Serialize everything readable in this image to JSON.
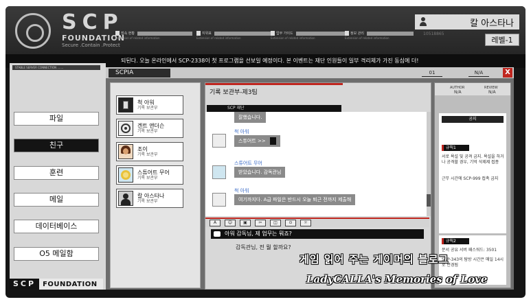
{
  "header": {
    "brand_name": "SCP",
    "brand_sub": "FOUNDATION",
    "brand_motto": "Secure .Contain .Protect",
    "fields": [
      {
        "label": "접속 현황",
        "sub": "Extension of related information"
      },
      {
        "label": "지위표",
        "sub": "Extension of related information"
      },
      {
        "label": "업무 가이드",
        "sub": "Extension of related information"
      },
      {
        "label": "정보 관리",
        "sub": "Extension of related information"
      }
    ],
    "user_name": "칼 아스타나",
    "user_id": "10518865",
    "level": "레벨-1"
  },
  "ticker": "되된다. 오늘 온라인에서 SCP-2338이 첫 프로그램을 선보일 예정이다. 본 이벤트는 재단 인원들이 일부 격리체가 가진 동심에 더!",
  "sidebar": {
    "connection_label": "STABLE SERVER CONNECTION .......",
    "items": [
      {
        "label": "파일",
        "active": false
      },
      {
        "label": "친구",
        "active": true
      },
      {
        "label": "훈련",
        "active": false
      },
      {
        "label": "메일",
        "active": false
      },
      {
        "label": "데이터베이스",
        "active": false
      },
      {
        "label": "O5 메일함",
        "active": false
      }
    ],
    "footer_logo": "SCP",
    "footer_text": "FOUNDATION"
  },
  "window": {
    "title": "SCPIA",
    "top_cells": [
      "01",
      "N/A"
    ],
    "close_label": "X"
  },
  "contacts": [
    {
      "name": "척 아워",
      "role": "기록 보관부",
      "avatar_icon": "robot-avatar-icon"
    },
    {
      "name": "겐트 앤더슨",
      "role": "기록 보관부",
      "avatar_icon": "target-avatar-icon"
    },
    {
      "name": "조이",
      "role": "기록 보관부",
      "avatar_icon": "woman-avatar-icon"
    },
    {
      "name": "스튜어트 무어",
      "role": "기록 보관부",
      "avatar_icon": "lion-avatar-icon"
    },
    {
      "name": "칼 아스타나",
      "role": "기록 보관부",
      "avatar_icon": "silhouette-avatar-icon"
    }
  ],
  "chat": {
    "title": "기록 보관부-제3팀",
    "subtitle": "SCP 재단",
    "messages": [
      {
        "name": "",
        "text": "잘했습니다."
      },
      {
        "name": "척 아워",
        "text": "스튜어트 >>"
      },
      {
        "name": "스튜어트 무어",
        "text": "받았습니다. 감독관님"
      },
      {
        "name": "척 아워",
        "text": "여기까지다. A급 파일은 반드시 오늘 퇴근 전까지 제출해"
      }
    ],
    "tools": [
      "A",
      "☺",
      "▣",
      "✂",
      "◫",
      "⊙",
      "☼"
    ],
    "question": "아워 감독님, 제 업무는 뭐죠?",
    "reply": "감독관님, 전 뭘 할까요?"
  },
  "right_panel": {
    "head": [
      "AUTHOR",
      "N/A",
      "REVIEW",
      "N/A"
    ],
    "notice_title": "공지",
    "rule1_tag": "규칙1",
    "rule1_text": "서로 욕설 및 공격 금지. 욕설을 하거나 공격할 경우, 기억 삭제제 접종",
    "rule1_extra": "근무 시간에 SCP-999 접촉 금지",
    "rule2_tag": "규칙2",
    "rule2_text": "문서 공유 서버 패스워드: 3501",
    "rule2_extra": "SCP-343의 탐방 시간은 매일 14시로 변경됨"
  },
  "watermark": {
    "line1": "게임 읽어 주는 게이머의 블로그",
    "line2": "LadyCALLA's Memories of Love"
  },
  "colors": {
    "accent_red": "#c0261f",
    "name_blue": "#3c6cc7",
    "dark": "#151515"
  }
}
